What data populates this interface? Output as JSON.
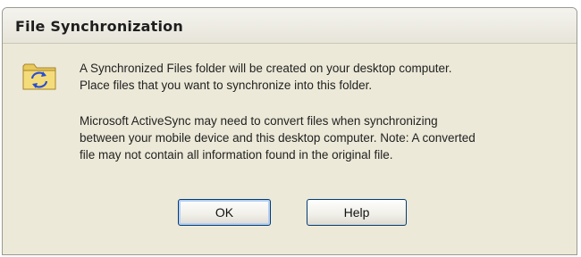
{
  "window": {
    "title": "File Synchronization"
  },
  "icon": {
    "name": "sync-folder-icon"
  },
  "message": {
    "paragraph1": [
      "A Synchronized Files folder will be created on your desktop computer.",
      "Place files that you want to synchronize into this folder."
    ],
    "paragraph2": [
      "Microsoft ActiveSync may need to convert files when synchronizing",
      "between your mobile device and this desktop computer.  Note: A converted",
      "file may not contain all information found in the original file."
    ]
  },
  "buttons": {
    "ok_label": "OK",
    "help_label": "Help"
  },
  "colors": {
    "dialog_background": "#ece9d8",
    "default_button_border": "#003c74"
  }
}
